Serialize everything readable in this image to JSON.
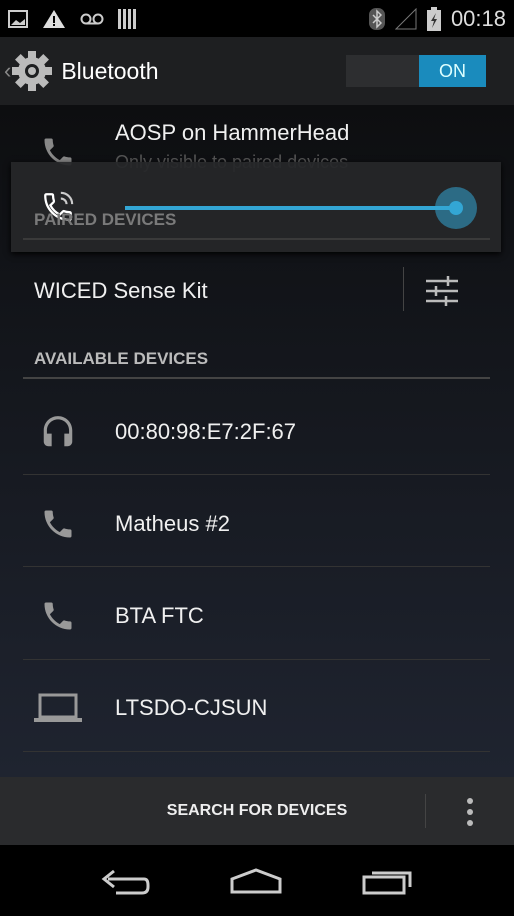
{
  "status": {
    "time": "00:18",
    "icons": [
      "image-icon",
      "warning-icon",
      "voicemail-icon",
      "barcode-icon",
      "bluetooth-icon",
      "signal-icon",
      "battery-charging-icon"
    ]
  },
  "actionbar": {
    "title": "Bluetooth",
    "toggle_label": "ON"
  },
  "device": {
    "name": "AOSP on HammerHead",
    "subtitle": "Only visible to paired devices"
  },
  "volume": {
    "level_percent": 100,
    "accent": "#33a6d4"
  },
  "paired": {
    "header": "PAIRED DEVICES",
    "items": [
      {
        "name": "WICED Sense Kit"
      }
    ]
  },
  "available": {
    "header": "AVAILABLE DEVICES",
    "items": [
      {
        "name": "00:80:98:E7:2F:67",
        "icon": "headphones-icon"
      },
      {
        "name": "Matheus #2",
        "icon": "phone-icon"
      },
      {
        "name": "BTA FTC",
        "icon": "phone-icon"
      },
      {
        "name": "LTSDO-CJSUN",
        "icon": "laptop-icon"
      }
    ]
  },
  "bottom": {
    "search_label": "SEARCH FOR DEVICES"
  }
}
